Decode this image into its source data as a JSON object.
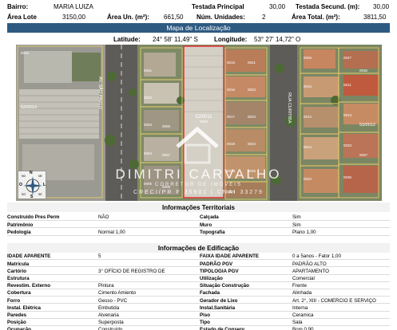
{
  "header": {
    "bairro_label": "Bairro:",
    "bairro_value": "MARIA LUIZA",
    "testada_principal_label": "Testada Principal",
    "testada_principal_value": "30,00",
    "testada_secund_label": "Testada Secund. (m):",
    "testada_secund_value": "30,00",
    "area_lote_label": "Área Lote",
    "area_lote_value": "3150,00",
    "area_un_label": "Área Un. (m²):",
    "area_un_value": "661,50",
    "num_unidades_label": "Núm. Unidades:",
    "num_unidades_value": "2",
    "area_total_label": "Área Total. (m²):",
    "area_total_value": "3811,50"
  },
  "map_section": {
    "title": "Mapa de Localização",
    "latitude_label": "Latitude:",
    "latitude_value": "24° 58' 11,49\" S",
    "longitude_label": "Longitude:",
    "longitude_value": "53° 27' 14,72\" O",
    "parcel_label": "52/0011",
    "parcel_sub": "0000",
    "left_block_label": "52/0013",
    "right_block_label": "53/0012",
    "street_left": "AV. SÃO PAULO",
    "street_right": "RUA CURITIBA",
    "lot_numbers": [
      "0032",
      "0001",
      "0002",
      "0003",
      "0004",
      "0005",
      "0006",
      "0007",
      "0008",
      "0015",
      "0016",
      "0017",
      "0018",
      "0019",
      "0020",
      "0021",
      "0022",
      "0023",
      "0024",
      "0025",
      "0026",
      "0027",
      "0010",
      "0011",
      "0012",
      "0013",
      "0014",
      "0033",
      "0034",
      "0035",
      "0036",
      "0037"
    ],
    "compass": {
      "n": "N",
      "s": "S",
      "l": "L",
      "o": "O",
      "ne": "NE",
      "no": "NO",
      "se": "SE",
      "so": "SO"
    }
  },
  "watermark": {
    "main": "DIMITRI CARVALHO",
    "sub": "CORRETOR DE IMÓVEIS",
    "creci": "CRECI/PR F 35901 | CNAI 33279"
  },
  "territoriais": {
    "title": "Informações Territoriais",
    "rows": [
      {
        "l1": "Construído Pres Perm",
        "v1": "NÃO",
        "l2": "Calçada",
        "v2": "Sim"
      },
      {
        "l1": "Patrimônio",
        "v1": "",
        "l2": "Muro",
        "v2": "Sim"
      },
      {
        "l1": "Pedologia",
        "v1": "Normal 1,00",
        "l2": "Topografia",
        "v2": "Plano 1,00"
      }
    ]
  },
  "edificacao": {
    "title": "Informações de Edificação",
    "rows": [
      {
        "l1": "IDADE APARENTE",
        "v1": "5",
        "l2": "FAIXA IDADE APARENTE",
        "v2": "0 a 5anos - Fator 1,00"
      },
      {
        "l1": "Matrícula",
        "v1": "",
        "l2": "PADRÃO PGV",
        "v2": "PADRÃO ALTO"
      },
      {
        "l1": "Cartório",
        "v1": "3° OFÍCIO DE REGISTRO DE",
        "l2": "TIPOLOGIA PGV",
        "v2": "APARTAMENTO"
      },
      {
        "l1": "Estrutura",
        "v1": "",
        "l2": "Utilização",
        "v2": "Comercial"
      },
      {
        "l1": "Revestim. Externo",
        "v1": "Pintura",
        "l2": "Situação Construção",
        "v2": "Frente"
      },
      {
        "l1": "Cobertura",
        "v1": "Cimento Amiento",
        "l2": "Fachada",
        "v2": "Alinhada"
      },
      {
        "l1": "Forro",
        "v1": "Gesso - PVC",
        "l2": "Gerador de Lixo",
        "v2": "Art. 2°, XIII - COMERCIO E SERVIÇO"
      },
      {
        "l1": "Instal. Elétrica",
        "v1": "Embutida",
        "l2": "Instal.Sanitária",
        "v2": "Interna"
      },
      {
        "l1": "Paredes",
        "v1": "Alvenaria",
        "l2": "Piso",
        "v2": "Ceramica"
      },
      {
        "l1": "Posição",
        "v1": "Superposta",
        "l2": "Tipo",
        "v2": "Sala"
      },
      {
        "l1": "Ocupação",
        "v1": "Construído",
        "l2": "Estado de Conserv.",
        "v2": "Bom 0,90"
      }
    ]
  },
  "colors": {
    "section_bar": "#2e5a82",
    "parcel_outline": "#e03c3c",
    "lot_outline": "#f2d36b"
  }
}
